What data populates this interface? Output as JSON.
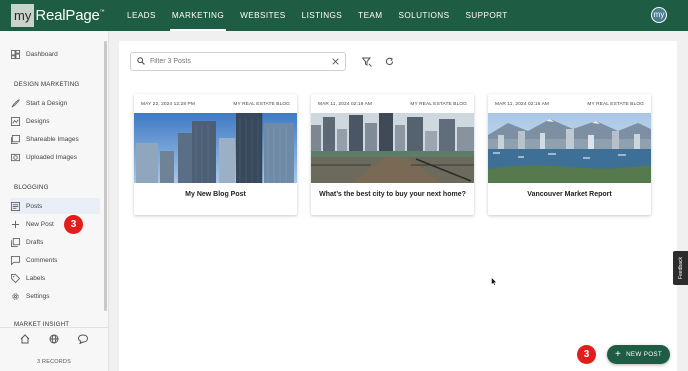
{
  "brand": {
    "logo_my": "my",
    "logo_name": "RealPage",
    "logo_tm": "™"
  },
  "nav": {
    "items": [
      {
        "label": "LEADS",
        "active": false
      },
      {
        "label": "MARKETING",
        "active": true
      },
      {
        "label": "WEBSITES",
        "active": false
      },
      {
        "label": "LISTINGS",
        "active": false
      },
      {
        "label": "TEAM",
        "active": false
      },
      {
        "label": "SOLUTIONS",
        "active": false
      },
      {
        "label": "SUPPORT",
        "active": false
      }
    ],
    "avatar_text": "my"
  },
  "sidebar": {
    "dashboard": {
      "label": "Dashboard",
      "icon": "dashboard-icon"
    },
    "design_marketing_heading": "DESIGN MARKETING",
    "design_items": [
      {
        "label": "Start a Design",
        "icon": "rocket-icon"
      },
      {
        "label": "Designs",
        "icon": "designs-icon"
      },
      {
        "label": "Shareable Images",
        "icon": "images-icon"
      },
      {
        "label": "Uploaded Images",
        "icon": "upload-image-icon"
      }
    ],
    "blogging_heading": "BLOGGING",
    "blogging_items": [
      {
        "label": "Posts",
        "icon": "posts-icon",
        "active": true
      },
      {
        "label": "New Post",
        "icon": "plus-icon"
      },
      {
        "label": "Drafts",
        "icon": "drafts-icon"
      },
      {
        "label": "Comments",
        "icon": "comments-icon"
      },
      {
        "label": "Labels",
        "icon": "label-icon"
      },
      {
        "label": "Settings",
        "icon": "gear-icon"
      }
    ],
    "market_insight_heading": "MARKET INSIGHT",
    "bottom_icons": [
      "home-icon",
      "globe-icon",
      "chat-icon"
    ],
    "records": "3 RECORDS"
  },
  "badges": {
    "new_post_count": "3",
    "fab_count": "3"
  },
  "toolbar": {
    "search_placeholder": "Filter 3 Posts",
    "filter_icon": "filter-icon",
    "refresh_icon": "refresh-icon"
  },
  "posts": [
    {
      "date": "MAY 22, 2024 12:28 PM",
      "blog": "MY REAL ESTATE BLOG",
      "title": "My New Blog Post"
    },
    {
      "date": "MAR 11, 2024 02:19 AM",
      "blog": "MY REAL ESTATE BLOG",
      "title": "What’s the best city to buy your next home?"
    },
    {
      "date": "MAR 11, 2024 02:16 AM",
      "blog": "MY REAL ESTATE BLOG",
      "title": "Vancouver Market Report"
    }
  ],
  "fab": {
    "label": "NEW POST"
  },
  "feedback": {
    "label": "Feedback"
  },
  "colors": {
    "brand_green": "#1e5c43",
    "badge_red": "#e31c1c",
    "active_item_bg": "#e9eef7"
  }
}
